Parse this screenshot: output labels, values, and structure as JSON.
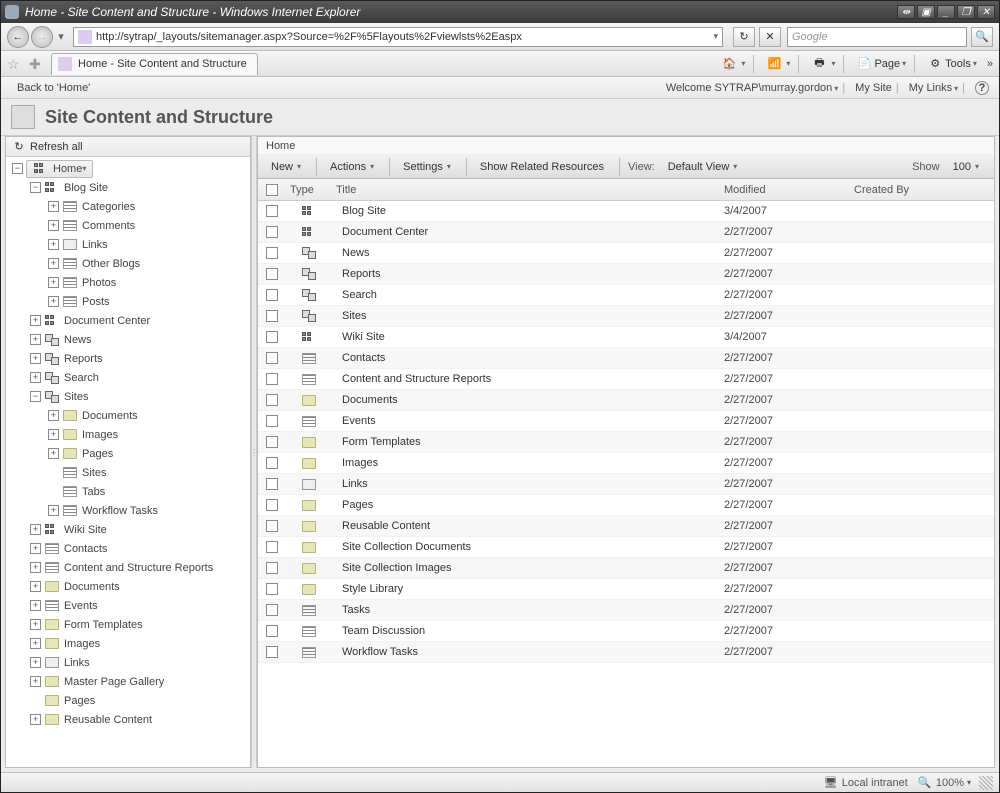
{
  "window": {
    "title": "Home - Site Content and Structure - Windows Internet Explorer",
    "win_buttons": [
      "◀▶",
      "▣",
      "_",
      "❐",
      "✕"
    ]
  },
  "nav": {
    "url": "http://sytrap/_layouts/sitemanager.aspx?Source=%2F%5Flayouts%2Fviewlsts%2Easpx",
    "search_placeholder": "Google"
  },
  "tabs": {
    "active_title": "Home - Site Content and Structure"
  },
  "ie_tools": {
    "page": "Page",
    "tools": "Tools"
  },
  "sp_top": {
    "back_link": "Back to 'Home'",
    "welcome_label": "Welcome SYTRAP\\murray.gordon",
    "links": [
      "My Site",
      "My Links"
    ]
  },
  "sp": {
    "page_title": "Site Content and Structure",
    "refresh": "Refresh all",
    "root": "Home"
  },
  "tree": [
    {
      "d": 0,
      "exp": "-",
      "icn": "site",
      "label": "Home",
      "sel": true
    },
    {
      "d": 1,
      "exp": "-",
      "icn": "site",
      "label": "Blog Site"
    },
    {
      "d": 2,
      "exp": "+",
      "icn": "list",
      "label": "Categories"
    },
    {
      "d": 2,
      "exp": "+",
      "icn": "list",
      "label": "Comments"
    },
    {
      "d": 2,
      "exp": "+",
      "icn": "links",
      "label": "Links"
    },
    {
      "d": 2,
      "exp": "+",
      "icn": "list",
      "label": "Other Blogs"
    },
    {
      "d": 2,
      "exp": "+",
      "icn": "list",
      "label": "Photos"
    },
    {
      "d": 2,
      "exp": "+",
      "icn": "list",
      "label": "Posts"
    },
    {
      "d": 1,
      "exp": "+",
      "icn": "site",
      "label": "Document Center"
    },
    {
      "d": 1,
      "exp": "+",
      "icn": "sub",
      "label": "News"
    },
    {
      "d": 1,
      "exp": "+",
      "icn": "sub",
      "label": "Reports"
    },
    {
      "d": 1,
      "exp": "+",
      "icn": "sub",
      "label": "Search"
    },
    {
      "d": 1,
      "exp": "-",
      "icn": "sub",
      "label": "Sites"
    },
    {
      "d": 2,
      "exp": "+",
      "icn": "folder",
      "label": "Documents"
    },
    {
      "d": 2,
      "exp": "+",
      "icn": "folder",
      "label": "Images"
    },
    {
      "d": 2,
      "exp": "+",
      "icn": "folder",
      "label": "Pages"
    },
    {
      "d": 2,
      "exp": "",
      "icn": "list",
      "label": "Sites"
    },
    {
      "d": 2,
      "exp": "",
      "icn": "list",
      "label": "Tabs"
    },
    {
      "d": 2,
      "exp": "+",
      "icn": "list",
      "label": "Workflow Tasks"
    },
    {
      "d": 1,
      "exp": "+",
      "icn": "site",
      "label": "Wiki Site"
    },
    {
      "d": 1,
      "exp": "+",
      "icn": "list",
      "label": "Contacts"
    },
    {
      "d": 1,
      "exp": "+",
      "icn": "list",
      "label": "Content and Structure Reports"
    },
    {
      "d": 1,
      "exp": "+",
      "icn": "folder",
      "label": "Documents"
    },
    {
      "d": 1,
      "exp": "+",
      "icn": "list",
      "label": "Events"
    },
    {
      "d": 1,
      "exp": "+",
      "icn": "folder",
      "label": "Form Templates"
    },
    {
      "d": 1,
      "exp": "+",
      "icn": "folder",
      "label": "Images"
    },
    {
      "d": 1,
      "exp": "+",
      "icn": "links",
      "label": "Links"
    },
    {
      "d": 1,
      "exp": "+",
      "icn": "folder",
      "label": "Master Page Gallery"
    },
    {
      "d": 1,
      "exp": "",
      "icn": "folder",
      "label": "Pages"
    },
    {
      "d": 1,
      "exp": "+",
      "icn": "folder",
      "label": "Reusable Content"
    }
  ],
  "crumb": "Home",
  "toolbar": {
    "new": "New",
    "actions": "Actions",
    "settings": "Settings",
    "show_related": "Show Related Resources",
    "view_label": "View:",
    "view_value": "Default View",
    "show_label": "Show",
    "show_value": "100"
  },
  "columns": {
    "type": "Type",
    "title": "Title",
    "modified": "Modified",
    "created_by": "Created By"
  },
  "rows": [
    {
      "icn": "site",
      "title": "Blog Site",
      "modified": "3/4/2007"
    },
    {
      "icn": "site",
      "title": "Document Center",
      "modified": "2/27/2007"
    },
    {
      "icn": "sub",
      "title": "News",
      "modified": "2/27/2007"
    },
    {
      "icn": "sub",
      "title": "Reports",
      "modified": "2/27/2007"
    },
    {
      "icn": "sub",
      "title": "Search",
      "modified": "2/27/2007"
    },
    {
      "icn": "sub",
      "title": "Sites",
      "modified": "2/27/2007"
    },
    {
      "icn": "site",
      "title": "Wiki Site",
      "modified": "3/4/2007"
    },
    {
      "icn": "list",
      "title": "Contacts",
      "modified": "2/27/2007"
    },
    {
      "icn": "list",
      "title": "Content and Structure Reports",
      "modified": "2/27/2007"
    },
    {
      "icn": "folder",
      "title": "Documents",
      "modified": "2/27/2007"
    },
    {
      "icn": "list",
      "title": "Events",
      "modified": "2/27/2007"
    },
    {
      "icn": "folder",
      "title": "Form Templates",
      "modified": "2/27/2007"
    },
    {
      "icn": "folder",
      "title": "Images",
      "modified": "2/27/2007"
    },
    {
      "icn": "links",
      "title": "Links",
      "modified": "2/27/2007"
    },
    {
      "icn": "folder",
      "title": "Pages",
      "modified": "2/27/2007"
    },
    {
      "icn": "folder",
      "title": "Reusable Content",
      "modified": "2/27/2007"
    },
    {
      "icn": "folder",
      "title": "Site Collection Documents",
      "modified": "2/27/2007"
    },
    {
      "icn": "folder",
      "title": "Site Collection Images",
      "modified": "2/27/2007"
    },
    {
      "icn": "folder",
      "title": "Style Library",
      "modified": "2/27/2007"
    },
    {
      "icn": "list",
      "title": "Tasks",
      "modified": "2/27/2007"
    },
    {
      "icn": "list",
      "title": "Team Discussion",
      "modified": "2/27/2007"
    },
    {
      "icn": "list",
      "title": "Workflow Tasks",
      "modified": "2/27/2007"
    }
  ],
  "status": {
    "zone": "Local intranet",
    "zoom": "100%"
  }
}
